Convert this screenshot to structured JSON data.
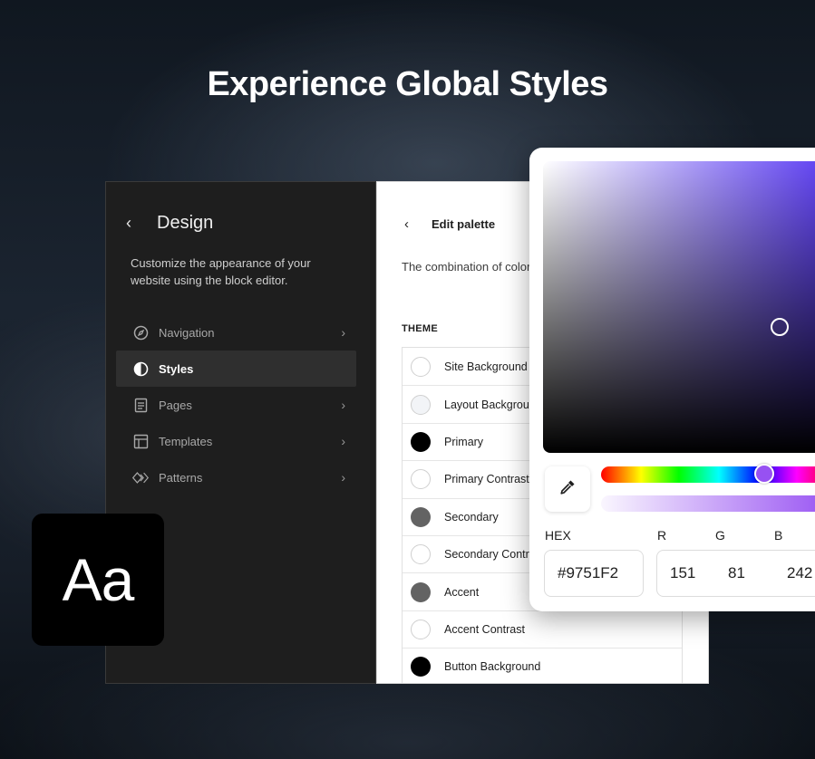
{
  "headline": "Experience Global Styles",
  "sidebar": {
    "back_label": "‹",
    "title": "Design",
    "description": "Customize the appearance of your website using the block editor.",
    "items": [
      {
        "label": "Navigation",
        "icon": "compass-icon",
        "active": false,
        "has_chevron": true
      },
      {
        "label": "Styles",
        "icon": "half-circle-icon",
        "active": true,
        "has_chevron": false
      },
      {
        "label": "Pages",
        "icon": "page-icon",
        "active": false,
        "has_chevron": true
      },
      {
        "label": "Templates",
        "icon": "layout-icon",
        "active": false,
        "has_chevron": true
      },
      {
        "label": "Patterns",
        "icon": "diamond-icon",
        "active": false,
        "has_chevron": true
      }
    ],
    "chevron": "›"
  },
  "palette": {
    "back_label": "‹",
    "title": "Edit palette",
    "description": "The combination of color color pickers.",
    "theme_label": "THEME",
    "swatches": [
      {
        "name": "Site Background",
        "color": "#ffffff"
      },
      {
        "name": "Layout Backgrou",
        "color": "#f2f4f7"
      },
      {
        "name": "Primary",
        "color": "#000000"
      },
      {
        "name": "Primary Contrast",
        "color": "#ffffff"
      },
      {
        "name": "Secondary",
        "color": "#636363"
      },
      {
        "name": "Secondary Contr",
        "color": "#ffffff"
      },
      {
        "name": "Accent",
        "color": "#636363"
      },
      {
        "name": "Accent Contrast",
        "color": "#ffffff"
      },
      {
        "name": "Button Background",
        "color": "#000000"
      }
    ]
  },
  "picker": {
    "hex_label": "HEX",
    "hex_value": "#9751F2",
    "r_label": "R",
    "r_value": "151",
    "g_label": "G",
    "g_value": "81",
    "b_label": "B",
    "b_value": "242",
    "selected_color": "#9751f2"
  },
  "badge": {
    "text": "Aa"
  }
}
